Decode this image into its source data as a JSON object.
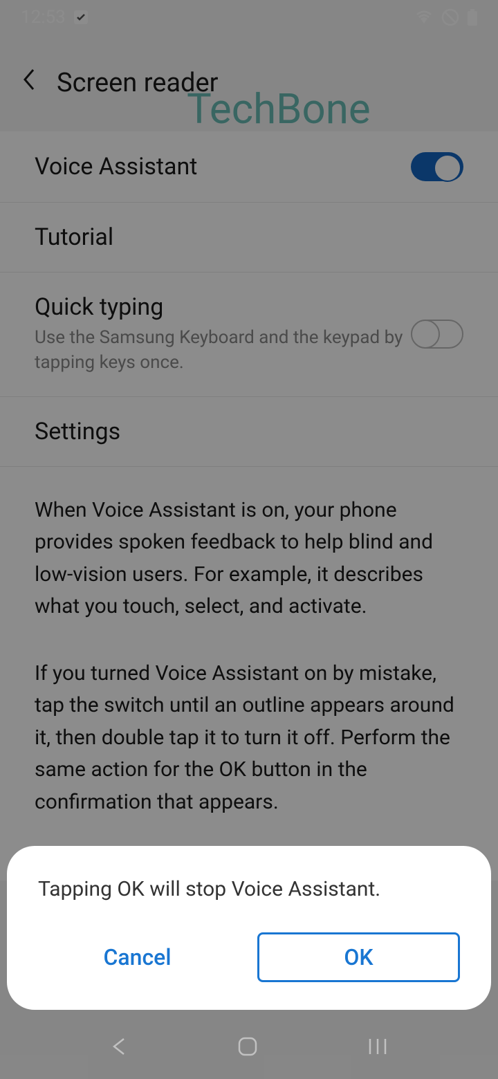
{
  "status": {
    "time": "12:53"
  },
  "header": {
    "title": "Screen reader"
  },
  "watermark": "TechBone",
  "items": {
    "voice_assistant": {
      "label": "Voice Assistant"
    },
    "tutorial": {
      "label": "Tutorial"
    },
    "quick_typing": {
      "label": "Quick typing",
      "subtitle": "Use the Samsung Keyboard and the keypad by tapping keys once."
    },
    "settings": {
      "label": "Settings"
    }
  },
  "description": {
    "p1": "When Voice Assistant is on, your phone provides spoken feedback to help blind and low-vision users. For example, it describes what you touch, select, and activate.",
    "p2": "If you turned Voice Assistant on by mistake, tap the switch until an outline appears around it, then double tap it to turn it off. Perform the same action for the OK button in the confirmation that appears."
  },
  "dialog": {
    "message": "Tapping OK will stop Voice Assistant.",
    "cancel": "Cancel",
    "ok": "OK"
  }
}
